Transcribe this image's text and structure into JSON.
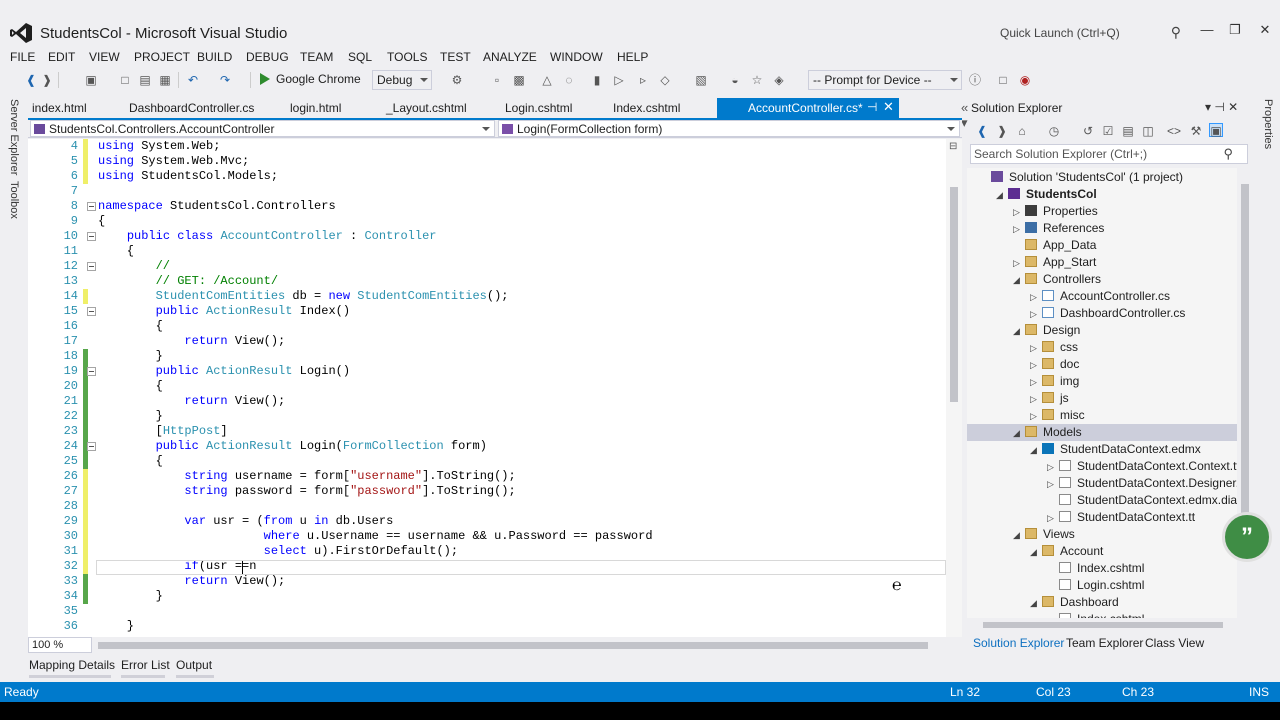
{
  "colors": {
    "accent": "#007acc",
    "status_bar": "#007acc",
    "chat_bubble": "#3f8d45"
  },
  "title": {
    "text": "StudentsCol - Microsoft Visual Studio",
    "quick_launch": "Quick Launch (Ctrl+Q)",
    "search_icon": "search-icon",
    "minimize": "—",
    "restore": "❐",
    "close": "✕"
  },
  "menu": [
    "FILE",
    "EDIT",
    "VIEW",
    "PROJECT",
    "BUILD",
    "DEBUG",
    "TEAM",
    "SQL",
    "TOOLS",
    "TEST",
    "ANALYZE",
    "WINDOW",
    "HELP"
  ],
  "toolbar": {
    "run_label": "Google Chrome",
    "config": "Debug",
    "device": "-- Prompt for Device --"
  },
  "side_strip": {
    "server_explorer": "Server Explorer",
    "toolbox": "Toolbox",
    "properties": "Properties"
  },
  "tabs": [
    "index.html",
    "DashboardController.cs",
    "login.html",
    "_Layout.cshtml",
    "Login.cshtml",
    "Index.cshtml"
  ],
  "active_tab": {
    "label": "AccountController.cs*",
    "pin": "⊣",
    "close": "✕"
  },
  "nav": {
    "left": "StudentsCol.Controllers.AccountController",
    "right": "Login(FormCollection form)"
  },
  "code": [
    {
      "ln": "4",
      "html": "<span style=\"color:#0000ff\">using</span> System.Web;",
      "chg": "yellow"
    },
    {
      "ln": "5",
      "html": "<span style=\"color:#0000ff\">using</span> System.Web.Mvc;",
      "chg": "yellow"
    },
    {
      "ln": "6",
      "html": "<span style=\"color:#0000ff\">using</span> StudentsCol.Models;",
      "chg": "yellow"
    },
    {
      "ln": "7",
      "html": ""
    },
    {
      "ln": "8",
      "html": "<span style=\"color:#0000ff\">namespace</span> StudentsCol.Controllers",
      "fold": true
    },
    {
      "ln": "9",
      "html": "{"
    },
    {
      "ln": "10",
      "html": "    <span style=\"color:#0000ff\">public class</span> <span style=\"color:#2b91af\">AccountController</span> : <span style=\"color:#2b91af\">Controller</span>",
      "fold": true
    },
    {
      "ln": "11",
      "html": "    {"
    },
    {
      "ln": "12",
      "html": "        <span style=\"color:#008000\">//</span>",
      "fold": true
    },
    {
      "ln": "13",
      "html": "        <span style=\"color:#008000\">// GET: /Account/</span>"
    },
    {
      "ln": "14",
      "html": "        <span style=\"color:#2b91af\">StudentComEntities</span> db = <span style=\"color:#0000ff\">new</span> <span style=\"color:#2b91af\">StudentComEntities</span>();",
      "chg": "yellow"
    },
    {
      "ln": "15",
      "html": "        <span style=\"color:#0000ff\">public</span> <span style=\"color:#2b91af\">ActionResult</span> Index()",
      "fold": true
    },
    {
      "ln": "16",
      "html": "        {"
    },
    {
      "ln": "17",
      "html": "            <span style=\"color:#0000ff\">return</span> View();"
    },
    {
      "ln": "18",
      "html": "        }",
      "chg": "green"
    },
    {
      "ln": "19",
      "html": "        <span style=\"color:#0000ff\">public</span> <span style=\"color:#2b91af\">ActionResult</span> Login()",
      "chg": "green",
      "fold": true
    },
    {
      "ln": "20",
      "html": "        {",
      "chg": "green"
    },
    {
      "ln": "21",
      "html": "            <span style=\"color:#0000ff\">return</span> View();",
      "chg": "green"
    },
    {
      "ln": "22",
      "html": "        }",
      "chg": "green"
    },
    {
      "ln": "23",
      "html": "        [<span style=\"color:#2b91af\">HttpPost</span>]",
      "chg": "green"
    },
    {
      "ln": "24",
      "html": "        <span style=\"color:#0000ff\">public</span> <span style=\"color:#2b91af\">ActionResult</span> Login(<span style=\"color:#2b91af\">FormCollection</span> form)",
      "chg": "green",
      "fold": true
    },
    {
      "ln": "25",
      "html": "        {",
      "chg": "green"
    },
    {
      "ln": "26",
      "html": "            <span style=\"color:#0000ff\">string</span> username = form[<span style=\"color:#a31515\">\"username\"</span>].ToString();",
      "chg": "yellow"
    },
    {
      "ln": "27",
      "html": "            <span style=\"color:#0000ff\">string</span> password = form[<span style=\"color:#a31515\">\"password\"</span>].ToString();",
      "chg": "yellow"
    },
    {
      "ln": "28",
      "html": "",
      "chg": "yellow"
    },
    {
      "ln": "29",
      "html": "            <span style=\"color:#0000ff\">var</span> usr = (<span style=\"color:#0000ff\">from</span> u <span style=\"color:#0000ff\">in</span> db.Users",
      "chg": "yellow"
    },
    {
      "ln": "30",
      "html": "                       <span style=\"color:#0000ff\">where</span> u.Username == username &amp;&amp; u.Password == password",
      "chg": "yellow"
    },
    {
      "ln": "31",
      "html": "                       <span style=\"color:#0000ff\">select</span> u).FirstOrDefault();",
      "chg": "yellow"
    },
    {
      "ln": "32",
      "html": "            <span style=\"color:#0000ff\">if</span>(usr ==n",
      "chg": "yellow"
    },
    {
      "ln": "33",
      "html": "            <span style=\"color:#0000ff\">return</span> View();",
      "chg": "green"
    },
    {
      "ln": "34",
      "html": "        }",
      "chg": "green"
    },
    {
      "ln": "35",
      "html": ""
    },
    {
      "ln": "36",
      "html": "    }"
    }
  ],
  "editor": {
    "zoom": "100 %"
  },
  "bottom_tabs": [
    "Mapping Details",
    "Error List",
    "Output"
  ],
  "solution_explorer": {
    "title": "Solution Explorer",
    "controls": "▾ ⊣ ✕",
    "search_placeholder": "Search Solution Explorer (Ctrl+;)",
    "tree": [
      {
        "label": "Solution 'StudentsCol' (1 project)",
        "depth": 0,
        "exp": "",
        "icon": "sol"
      },
      {
        "label": "StudentsCol",
        "depth": 1,
        "exp": "◢",
        "icon": "proj",
        "bold": true
      },
      {
        "label": "Properties",
        "depth": 2,
        "exp": "▷",
        "icon": "prop"
      },
      {
        "label": "References",
        "depth": 2,
        "exp": "▷",
        "icon": "ref"
      },
      {
        "label": "App_Data",
        "depth": 2,
        "exp": "",
        "icon": "folder"
      },
      {
        "label": "App_Start",
        "depth": 2,
        "exp": "▷",
        "icon": "folder"
      },
      {
        "label": "Controllers",
        "depth": 2,
        "exp": "◢",
        "icon": "folder"
      },
      {
        "label": "AccountController.cs",
        "depth": 3,
        "exp": "▷",
        "icon": "cs"
      },
      {
        "label": "DashboardController.cs",
        "depth": 3,
        "exp": "▷",
        "icon": "cs"
      },
      {
        "label": "Design",
        "depth": 2,
        "exp": "◢",
        "icon": "folder"
      },
      {
        "label": "css",
        "depth": 3,
        "exp": "▷",
        "icon": "folder"
      },
      {
        "label": "doc",
        "depth": 3,
        "exp": "▷",
        "icon": "folder"
      },
      {
        "label": "img",
        "depth": 3,
        "exp": "▷",
        "icon": "folder"
      },
      {
        "label": "js",
        "depth": 3,
        "exp": "▷",
        "icon": "folder"
      },
      {
        "label": "misc",
        "depth": 3,
        "exp": "▷",
        "icon": "folder"
      },
      {
        "label": "Models",
        "depth": 2,
        "exp": "◢",
        "icon": "folder",
        "selected": true
      },
      {
        "label": "StudentDataContext.edmx",
        "depth": 3,
        "exp": "◢",
        "icon": "edmx"
      },
      {
        "label": "StudentDataContext.Context.tt",
        "depth": 4,
        "exp": "▷",
        "icon": "file"
      },
      {
        "label": "StudentDataContext.Designer.cs",
        "depth": 4,
        "exp": "▷",
        "icon": "file"
      },
      {
        "label": "StudentDataContext.edmx.diagram",
        "depth": 4,
        "exp": "",
        "icon": "file"
      },
      {
        "label": "StudentDataContext.tt",
        "depth": 4,
        "exp": "▷",
        "icon": "file"
      },
      {
        "label": "Views",
        "depth": 2,
        "exp": "◢",
        "icon": "folder"
      },
      {
        "label": "Account",
        "depth": 3,
        "exp": "◢",
        "icon": "folder"
      },
      {
        "label": "Index.cshtml",
        "depth": 4,
        "exp": "",
        "icon": "file"
      },
      {
        "label": "Login.cshtml",
        "depth": 4,
        "exp": "",
        "icon": "file"
      },
      {
        "label": "Dashboard",
        "depth": 3,
        "exp": "◢",
        "icon": "folder"
      },
      {
        "label": "Index.cshtml",
        "depth": 4,
        "exp": "",
        "icon": "file"
      }
    ],
    "tabs": [
      "Solution Explorer",
      "Team Explorer",
      "Class View"
    ]
  },
  "status": {
    "ready": "Ready",
    "ln": "Ln 32",
    "col": "Col 23",
    "ch": "Ch 23",
    "ins": "INS"
  },
  "chat_icon": "quote-icon"
}
